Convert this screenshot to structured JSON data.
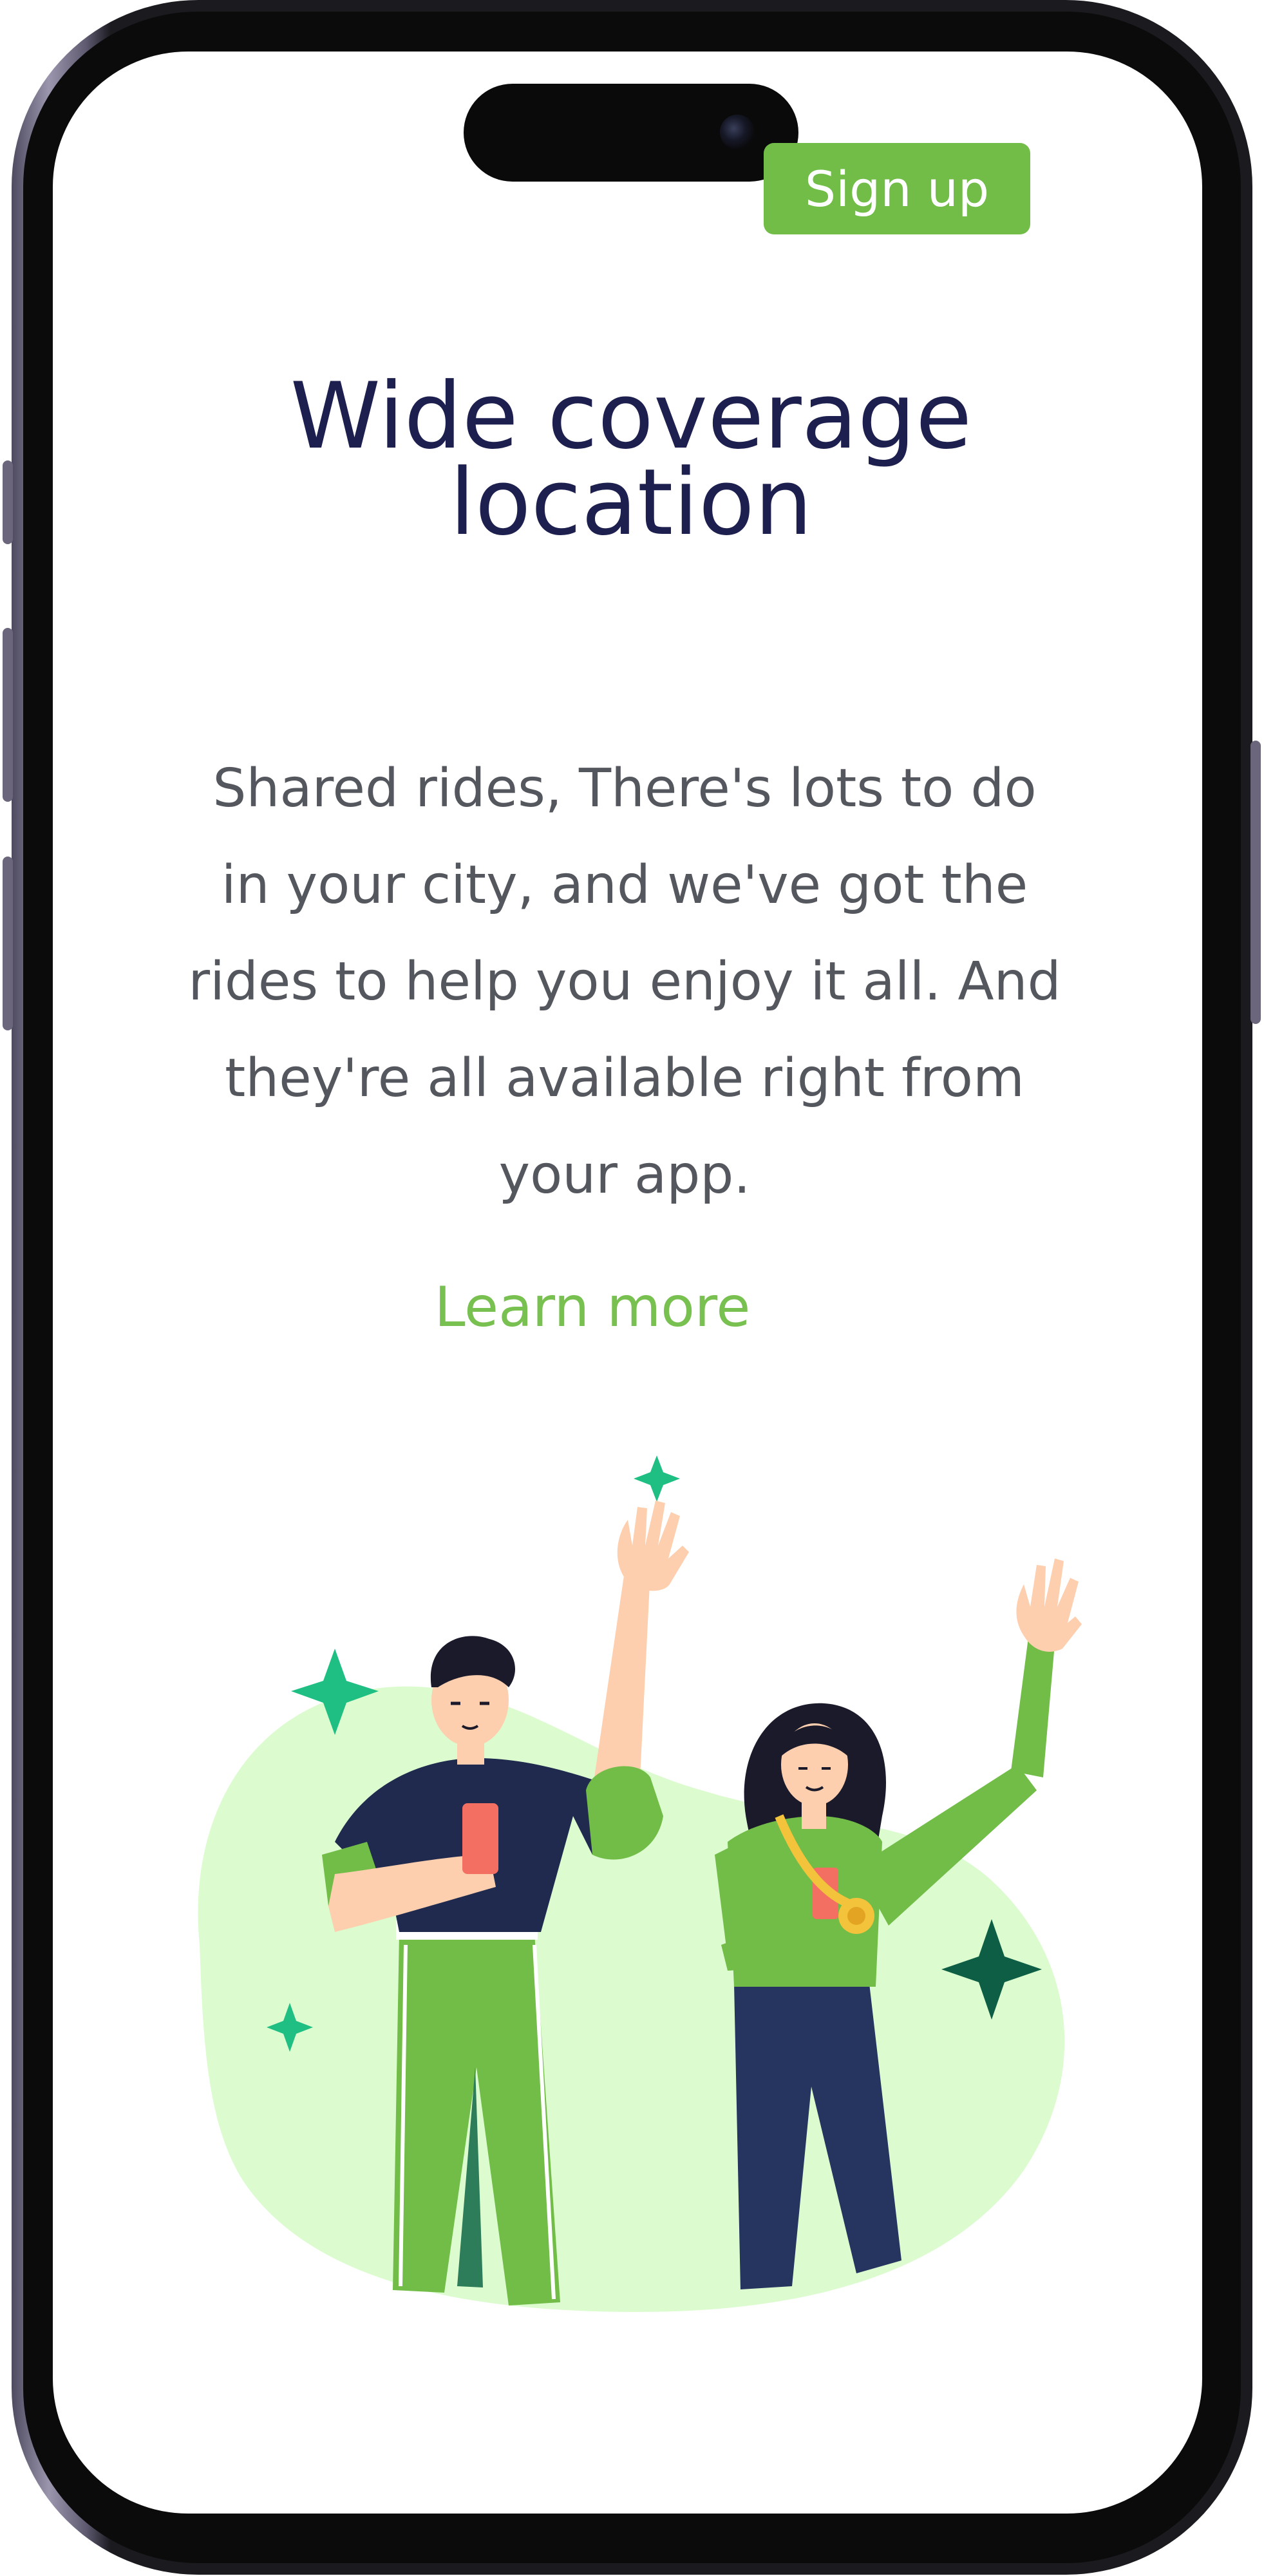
{
  "header": {
    "signup_label": "Sign up"
  },
  "hero": {
    "title_line1": "Wide coverage",
    "title_line2": "location",
    "description": "Shared rides, There's lots to do in your city, and we've got the rides to help you enjoy it all. And they're all available right from your app.",
    "learn_more_label": "Learn more"
  },
  "illustration": {
    "name": "two-people-waving-illustration"
  },
  "colors": {
    "accent_green": "#71bd47",
    "title_navy": "#1d1f4e",
    "body_gray": "#55575e",
    "blob_light_green": "#dcfcd0",
    "sparkle_teal": "#1fbf84"
  }
}
